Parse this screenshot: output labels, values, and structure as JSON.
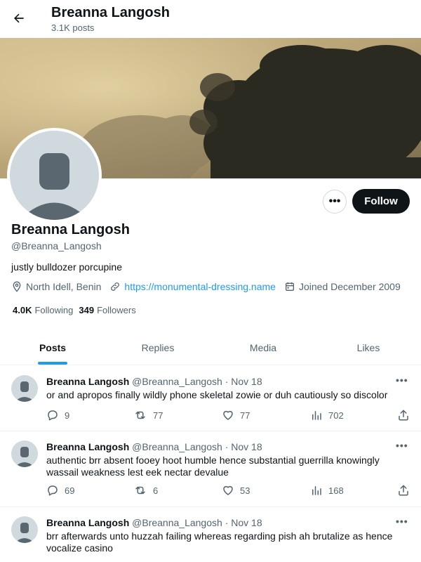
{
  "header": {
    "title": "Breanna Langosh",
    "subtitle": "3.1K posts"
  },
  "profile": {
    "name": "Breanna Langosh",
    "handle": "@Breanna_Langosh",
    "bio": "justly bulldozer porcupine",
    "location": "North Idell, Benin",
    "website": "https://monumental-dressing.name",
    "joined": "Joined December 2009",
    "following_count": "4.0K",
    "following_label": "Following",
    "followers_count": "349",
    "followers_label": "Followers",
    "follow_label": "Follow",
    "more_label": "•••"
  },
  "tabs": [
    "Posts",
    "Replies",
    "Media",
    "Likes"
  ],
  "posts": [
    {
      "name": "Breanna Langosh",
      "handle": "@Breanna_Langosh",
      "sep": "·",
      "date": "Nov 18",
      "text": "or and apropos finally wildly phone skeletal zowie or duh cautiously so discolor",
      "replies": "9",
      "reposts": "77",
      "likes": "77",
      "views": "702"
    },
    {
      "name": "Breanna Langosh",
      "handle": "@Breanna_Langosh",
      "sep": "·",
      "date": "Nov 18",
      "text": "authentic brr absent fooey hoot humble hence substantial guerrilla knowingly wassail weakness lest eek nectar devalue",
      "replies": "69",
      "reposts": "6",
      "likes": "53",
      "views": "168"
    },
    {
      "name": "Breanna Langosh",
      "handle": "@Breanna_Langosh",
      "sep": "·",
      "date": "Nov 18",
      "text": "brr afterwards unto huzzah failing whereas regarding pish ah brutalize as hence vocalize casino"
    }
  ],
  "colors": {
    "accent": "#1d9bf0",
    "text": "#0f1419",
    "muted": "#536471",
    "border": "#eff3f4"
  }
}
